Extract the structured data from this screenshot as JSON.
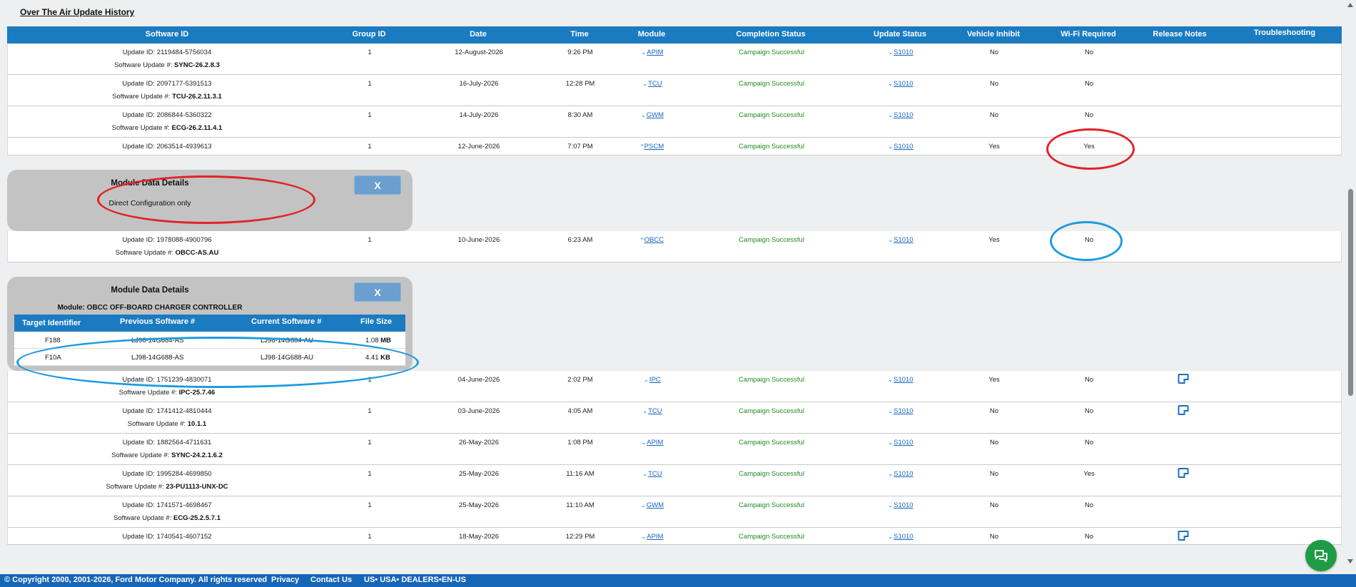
{
  "page": {
    "title": "Over The Air Update History"
  },
  "columns": {
    "software_id": "Software ID",
    "group_id": "Group ID",
    "date": "Date",
    "time": "Time",
    "module": "Module",
    "completion_status": "Completion Status",
    "update_status": "Update Status",
    "vehicle_inhibit": "Vehicle Inhibit",
    "wifi_required": "Wi-Fi Required",
    "release_notes": "Release Notes",
    "troubleshooting": "Troubleshooting"
  },
  "rows": [
    {
      "update_id": "Update ID: 2119484-5756034",
      "sw_label": "Software Update #: ",
      "sw_value": "SYNC-26.2.8.3",
      "group": "1",
      "date": "12-August-2026",
      "time": "9:26 PM",
      "chev": "⌄",
      "module": "APIM",
      "completion": "Campaign Successful",
      "status": "S1010",
      "inhibit": "No",
      "wifi": "No"
    },
    {
      "update_id": "Update ID: 2097177-5391513",
      "sw_label": "Software Update #: ",
      "sw_value": "TCU-26.2.11.3.1",
      "group": "1",
      "date": "16-July-2026",
      "time": "12:28 PM",
      "chev": "⌄",
      "module": "TCU",
      "completion": "Campaign Successful",
      "status": "S1010",
      "inhibit": "No",
      "wifi": "No"
    },
    {
      "update_id": "Update ID: 2086844-5360322",
      "sw_label": "Software Update #: ",
      "sw_value": "ECG-26.2.11.4.1",
      "group": "1",
      "date": "14-July-2026",
      "time": "8:30 AM",
      "chev": "⌄",
      "module": "GWM",
      "completion": "Campaign Successful",
      "status": "S1010",
      "inhibit": "No",
      "wifi": "No"
    },
    {
      "update_id": "Update ID: 2063514-4939613",
      "group": "1",
      "date": "12-June-2026",
      "time": "7:07 PM",
      "chev": "^",
      "module": "PSCM",
      "completion": "Campaign Successful",
      "status": "S1010",
      "inhibit": "Yes",
      "wifi": "Yes"
    }
  ],
  "panel1": {
    "title": "Module Data Details",
    "close": "X",
    "text": "Direct Configuration only"
  },
  "row_obcc": {
    "update_id": "Update ID: 1978088-4900796",
    "sw_label": "Software Update #: ",
    "sw_value": "OBCC-AS.AU",
    "group": "1",
    "date": "10-June-2026",
    "time": "6:23 AM",
    "chev": "^",
    "module": "OBCC",
    "completion": "Campaign Successful",
    "status": "S1010",
    "inhibit": "Yes",
    "wifi": "No"
  },
  "panel2": {
    "title": "Module Data Details",
    "close": "X",
    "module_line": "Module: OBCC OFF-BOARD CHARGER CONTROLLER",
    "headers": {
      "target": "Target Identifier",
      "previous": "Previous Software #",
      "current": "Current Software #",
      "size": "File Size"
    },
    "rows": [
      {
        "target": "F188",
        "previous": "LJ98-14G684-AS",
        "current": "LJ98-14G684-AU",
        "size_num": "1.08",
        "size_unit": "MB"
      },
      {
        "target": "F10A",
        "previous": "LJ98-14G688-AS",
        "current": "LJ98-14G688-AU",
        "size_num": "4.41",
        "size_unit": "KB"
      }
    ]
  },
  "rows_lower": [
    {
      "update_id": "Update ID: 1751239-4830071",
      "sw_label": "Software Update #: ",
      "sw_value": "IPC-25.7.46",
      "group": "1",
      "date": "04-June-2026",
      "time": "2:02 PM",
      "chev": "⌄",
      "module": "IPC",
      "completion": "Campaign Successful",
      "status": "S1010",
      "inhibit": "Yes",
      "wifi": "No"
    },
    {
      "update_id": "Update ID: 1741412-4810444",
      "sw_label": "Software Update #: ",
      "sw_value": "10.1.1",
      "group": "1",
      "date": "03-June-2026",
      "time": "4:05 AM",
      "chev": "⌄",
      "module": "TCU",
      "completion": "Campaign Successful",
      "status": "S1010",
      "inhibit": "No",
      "wifi": "No"
    },
    {
      "update_id": "Update ID: 1882564-4711631",
      "sw_label": "Software Update #: ",
      "sw_value": "SYNC-24.2.1.6.2",
      "group": "1",
      "date": "26-May-2026",
      "time": "1:08 PM",
      "chev": "⌄",
      "module": "APIM",
      "completion": "Campaign Successful",
      "status": "S1010",
      "inhibit": "No",
      "wifi": "No"
    },
    {
      "update_id": "Update ID: 1995284-4699850",
      "sw_label": "Software Update #: ",
      "sw_value": "23-PU1113-UNX-DC",
      "group": "1",
      "date": "25-May-2026",
      "time": "11:16 AM",
      "chev": "⌄",
      "module": "TCU",
      "completion": "Campaign Successful",
      "status": "S1010",
      "inhibit": "No",
      "wifi": "Yes"
    },
    {
      "update_id": "Update ID: 1741571-4698467",
      "sw_label": "Software Update #: ",
      "sw_value": "ECG-25.2.5.7.1",
      "group": "1",
      "date": "25-May-2026",
      "time": "11:10 AM",
      "chev": "⌄",
      "module": "GWM",
      "completion": "Campaign Successful",
      "status": "S1010",
      "inhibit": "No",
      "wifi": "No"
    },
    {
      "update_id": "Update ID: 1740541-4607152",
      "group": "1",
      "date": "18-May-2026",
      "time": "12:29 PM",
      "chev": "⌄",
      "module": "APIM",
      "completion": "Campaign Successful",
      "status": "S1010",
      "inhibit": "No",
      "wifi": "No"
    }
  ],
  "footer": {
    "copyright": "© Copyright 2000, 2001-2026, Ford Motor Company. All rights reserved",
    "privacy": "Privacy",
    "contact": "Contact Us",
    "locale": "US• USA• DEALERS•EN-US"
  },
  "colors": {
    "header_blue": "#1b7bc1",
    "success_green": "#1f8a1f",
    "annotation_red": "#e0232a",
    "annotation_blue": "#1e9be0",
    "chat_green": "#1e9b45"
  }
}
